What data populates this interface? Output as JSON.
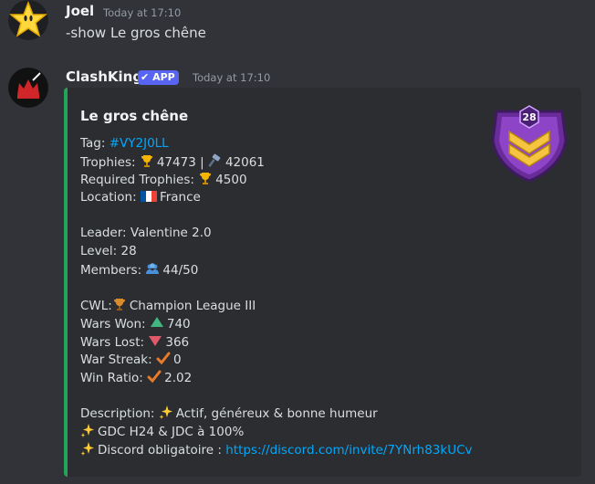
{
  "messages": [
    {
      "username": "Joel",
      "timestamp": "Today at 17:10",
      "content": "-show Le gros chêne",
      "avatar_icon": "star-icon"
    },
    {
      "username": "ClashKing",
      "badge": "APP",
      "timestamp": "Today at 17:10",
      "avatar_icon": "crown-icon"
    }
  ],
  "embed": {
    "accent_color": "#23a559",
    "title": "Le gros chêne",
    "tag_label": "Tag:",
    "tag_value": "#VY2J0LL",
    "trophies_label": "Trophies:",
    "trophies_value": "47473",
    "trophies_sep": "|",
    "builder_trophies_value": "42061",
    "required_label": "Required Trophies:",
    "required_value": "4500",
    "location_label": "Location:",
    "location_value": "France",
    "leader": "Leader: Valentine 2.0",
    "level": "Level: 28",
    "members_label": "Members:",
    "members_value": "44/50",
    "cwl_label": "CWL:",
    "cwl_value": "Champion League III",
    "wars_won_label": "Wars Won:",
    "wars_won_value": "740",
    "wars_lost_label": "Wars Lost:",
    "wars_lost_value": "366",
    "war_streak_label": "War Streak:",
    "war_streak_value": "0",
    "win_ratio_label": "Win Ratio:",
    "win_ratio_value": "2.02",
    "description_label": "Description:",
    "description_line1": "Actif, généreux & bonne humeur",
    "description_line2": "GDC H24 & JDC à 100%",
    "description_line3_text": "Discord obligatoire :",
    "description_link": "https://discord.com/invite/7YNrh83kUCv",
    "badge_level": "28"
  }
}
